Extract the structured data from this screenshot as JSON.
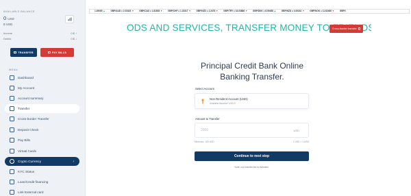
{
  "sidebar": {
    "balance_label": "AVAILABLE BALANCE",
    "balance_amount": "0",
    "balance_currency": "USD",
    "secondary_amount": "0",
    "secondary_currency": "USD",
    "income_label": "Income",
    "income_value": "0 $ ↑",
    "debits_label": "Debits",
    "debits_value": "0 $ ↓",
    "transfer_button": "TRANSFER",
    "pay_bills_button": "PAY BILLS",
    "menu_label": "MENU",
    "items": [
      {
        "label": "Dashboard",
        "icon": "dashboard-icon"
      },
      {
        "label": "My Account",
        "icon": "account-icon"
      },
      {
        "label": "Account summary",
        "icon": "summary-icon"
      },
      {
        "label": "Transfer",
        "icon": "transfer-icon"
      },
      {
        "label": "Cross-border Transfer",
        "icon": "globe-icon"
      },
      {
        "label": "Deposit Check",
        "icon": "check-icon"
      },
      {
        "label": "Pay Bills",
        "icon": "bill-icon"
      },
      {
        "label": "Virtual Cards",
        "icon": "card-icon"
      },
      {
        "label": "Crypto Currency",
        "icon": "crypto-icon"
      },
      {
        "label": "KYC Status",
        "icon": "kyc-icon"
      },
      {
        "label": "Loan/Credit financing",
        "icon": "loan-icon"
      },
      {
        "label": "Link External card",
        "icon": "link-icon"
      }
    ],
    "crypto_chevron": "›"
  },
  "ticker": [
    {
      "text": "1.49065",
      "arrow": "▲",
      "dir": "up"
    },
    {
      "text": "GBP/AUD = 2.03419",
      "arrow": "▼",
      "dir": "dn"
    },
    {
      "text": "GBP/CAD = 1.81853",
      "arrow": "▼",
      "dir": "dn"
    },
    {
      "text": "GBP/CHF = 1.23317",
      "arrow": "▼",
      "dir": "dn"
    },
    {
      "text": "GBP/NZD = 1.2478",
      "arrow": "▼",
      "dir": "dn"
    },
    {
      "text": "GBP/TRY = 34.03886",
      "arrow": "▼",
      "dir": "dn"
    },
    {
      "text": "GBP/DKK = 8.59458",
      "arrow": "▲",
      "dir": "up"
    },
    {
      "text": "GBP/NZD = 4.00341",
      "arrow": "▼",
      "dir": "dn"
    },
    {
      "text": "GBP/NOK = 11.62466",
      "arrow": "▼",
      "dir": "dn"
    },
    {
      "text": "GBP/I",
      "arrow": "",
      "dir": "dn"
    }
  ],
  "banner": {
    "text": "ODS AND SERVICES, TRANSFER MONEY TO FRIENDS",
    "cross_border_button": "Cross-border transfer"
  },
  "form": {
    "title": "Principal Credit Bank Online Banking Transfer.",
    "select_account_label": "Select Account",
    "account_name": "Non Resident Account (USD)",
    "account_balance": "Available Balance: USD 0",
    "amount_label": "Amount to Transfer",
    "amount_placeholder": "2000",
    "amount_currency": "USD",
    "minimum_text": "Minimum: 100 USD",
    "rate_text": "1 USD = 1 USD",
    "continue_button": "Continue to next step",
    "note": "Note: our transfer fee is included."
  },
  "colors": {
    "primary": "#123a66",
    "danger": "#d63a36",
    "banner_text": "#23b6a3",
    "sidebar_bg": "#eef2f6"
  }
}
